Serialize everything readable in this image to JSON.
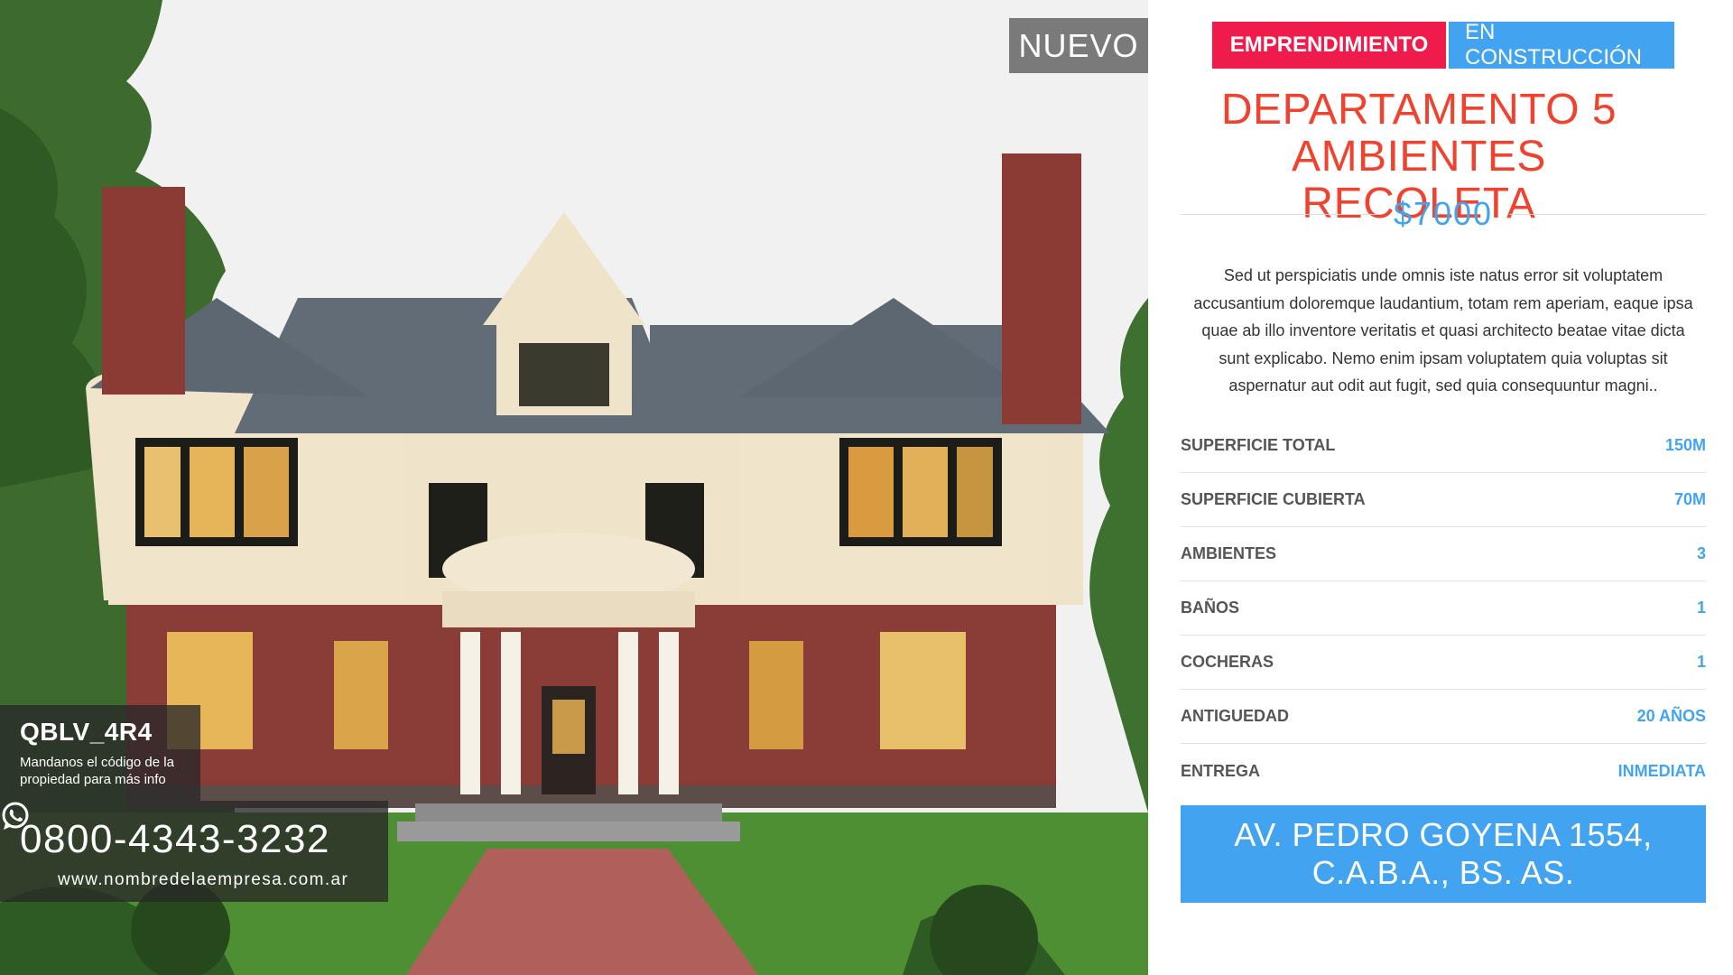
{
  "photo": {
    "badge": "NUEVO",
    "property_code": "QBLV_4R4",
    "code_hint": "Mandanos el código de la propiedad para más info",
    "phone": "0800-4343-3232",
    "website": "www.nombredelaempresa.com.ar",
    "phone_icon": "whatsapp-icon"
  },
  "tags": {
    "primary": "EMPRENDIMIENTO",
    "secondary": "EN CONSTRUCCIÓN"
  },
  "listing": {
    "title": "DEPARTAMENTO 5 AMBIENTES RECOLETA",
    "price": "$7000",
    "description": "Sed ut perspiciatis unde omnis iste natus error sit voluptatem accusantium doloremque laudantium, totam rem aperiam, eaque ipsa quae ab illo inventore veritatis et quasi architecto beatae vitae dicta sunt explicabo. Nemo enim ipsam voluptatem quia voluptas sit aspernatur aut odit aut fugit, sed quia consequuntur magni..",
    "address": "AV. PEDRO GOYENA 1554, C.A.B.A., BS. AS."
  },
  "specs": [
    {
      "label": "SUPERFICIE TOTAL",
      "value": "150M"
    },
    {
      "label": "SUPERFICIE CUBIERTA",
      "value": "70M"
    },
    {
      "label": "AMBIENTES",
      "value": "3"
    },
    {
      "label": "BAÑOS",
      "value": "1"
    },
    {
      "label": "COCHERAS",
      "value": "1"
    },
    {
      "label": "ANTIGUEDAD",
      "value": "20 AÑOS"
    },
    {
      "label": "ENTREGA",
      "value": "INMEDIATA"
    }
  ],
  "colors": {
    "accent_blue": "#42a4f0",
    "accent_red": "#ef1c4b",
    "title_red": "#ef4330",
    "overlay_dark": "#282828"
  }
}
